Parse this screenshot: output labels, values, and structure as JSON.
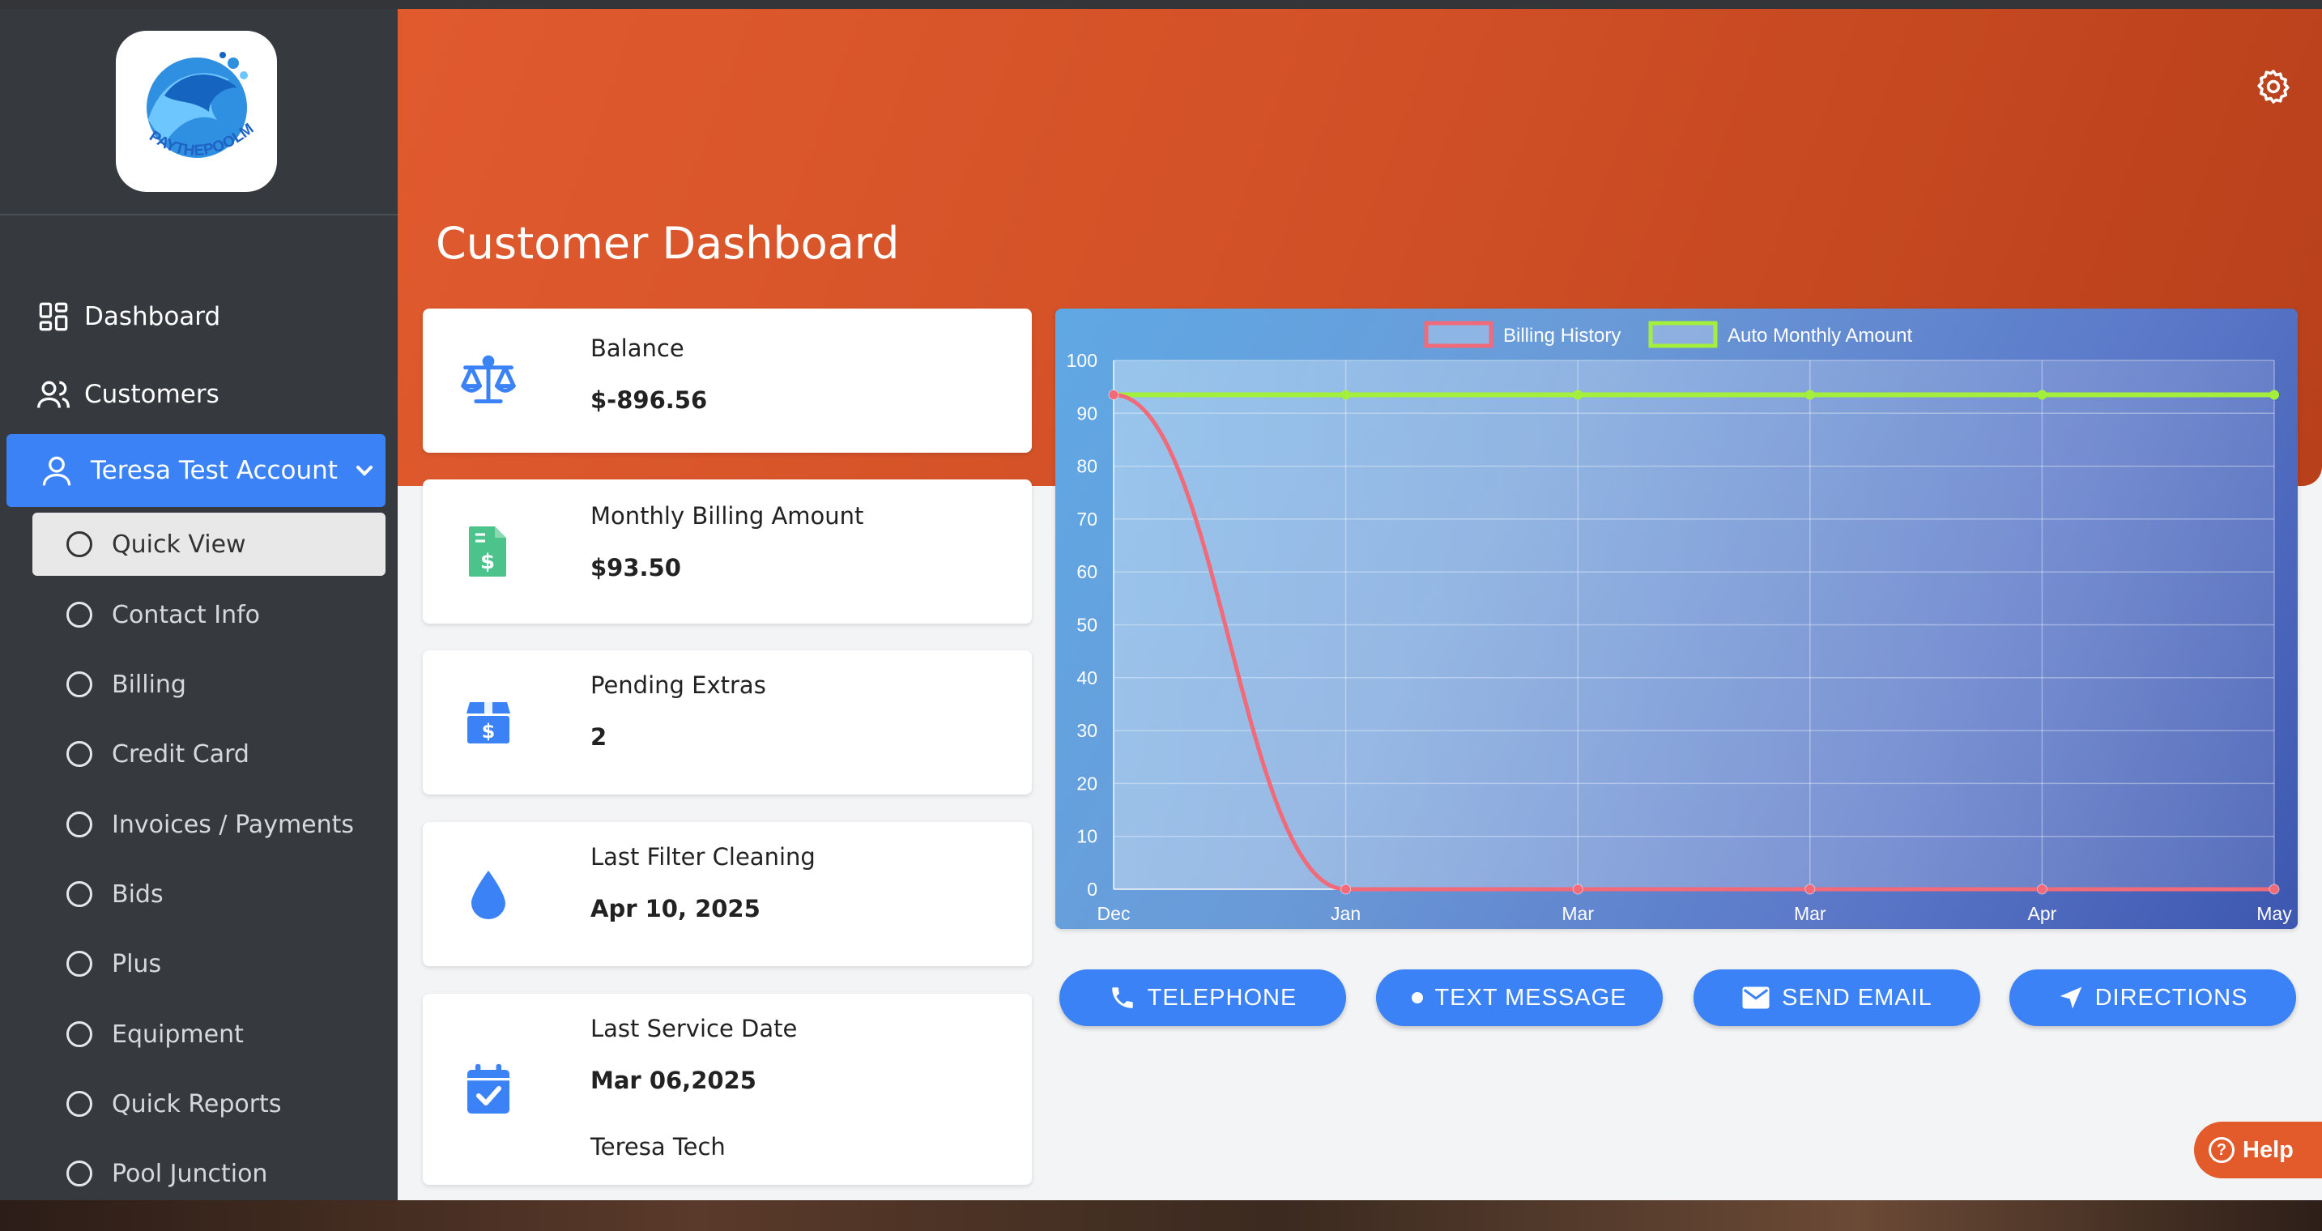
{
  "sidebar": {
    "logo_text": "PAYTHEPOOLMAN",
    "nav": [
      {
        "label": "Dashboard",
        "icon": "dashboard-grid-icon"
      },
      {
        "label": "Customers",
        "icon": "users-icon"
      }
    ],
    "active": {
      "label": "Teresa Test Account",
      "icon": "user-icon"
    },
    "sub_items": [
      {
        "label": "Quick View"
      },
      {
        "label": "Contact Info"
      },
      {
        "label": "Billing"
      },
      {
        "label": "Credit Card"
      },
      {
        "label": "Invoices / Payments"
      },
      {
        "label": "Bids"
      },
      {
        "label": "Plus"
      },
      {
        "label": "Equipment"
      },
      {
        "label": "Quick Reports"
      },
      {
        "label": "Pool Junction"
      }
    ]
  },
  "header": {
    "title": "Customer Dashboard",
    "settings_icon": "gear-icon"
  },
  "cards": [
    {
      "label": "Balance",
      "value": "$-896.56",
      "icon": "scale-icon",
      "color": "#3b82f6"
    },
    {
      "label": "Monthly Billing Amount",
      "value": "$93.50",
      "icon": "invoice-dollar-icon",
      "color": "#4cc38a"
    },
    {
      "label": "Pending Extras",
      "value": "2",
      "icon": "box-dollar-icon",
      "color": "#3b82f6"
    },
    {
      "label": "Last Filter Cleaning",
      "value": "Apr 10, 2025",
      "icon": "water-drop-icon",
      "color": "#3b82f6"
    },
    {
      "label": "Last Service Date",
      "value": "Mar 06,2025",
      "extra": "Teresa Tech",
      "icon": "calendar-check-icon",
      "color": "#3b82f6"
    }
  ],
  "chart_data": {
    "type": "line",
    "categories": [
      "Dec",
      "Jan",
      "Mar",
      "Mar",
      "Apr",
      "May"
    ],
    "series": [
      {
        "name": "Billing History",
        "values": [
          93.5,
          0,
          0,
          0,
          0,
          0
        ],
        "color": "#f06a7a"
      },
      {
        "name": "Auto Monthly Amount",
        "values": [
          93.5,
          93.5,
          93.5,
          93.5,
          93.5,
          93.5
        ],
        "color": "#a4ee3c"
      }
    ],
    "ylim": [
      0,
      100
    ],
    "yticks": [
      "0",
      "10",
      "20",
      "30",
      "40",
      "50",
      "60",
      "70",
      "80",
      "90",
      "100"
    ],
    "grid": true,
    "legend": "top-center"
  },
  "actions": [
    {
      "label": "TELEPHONE",
      "icon": "phone-icon"
    },
    {
      "label": "TEXT MESSAGE",
      "icon": "dot-icon"
    },
    {
      "label": "SEND EMAIL",
      "icon": "envelope-icon"
    },
    {
      "label": "DIRECTIONS",
      "icon": "navigation-arrow-icon"
    }
  ],
  "help": {
    "label": "Help",
    "icon": "question-circle-icon"
  }
}
